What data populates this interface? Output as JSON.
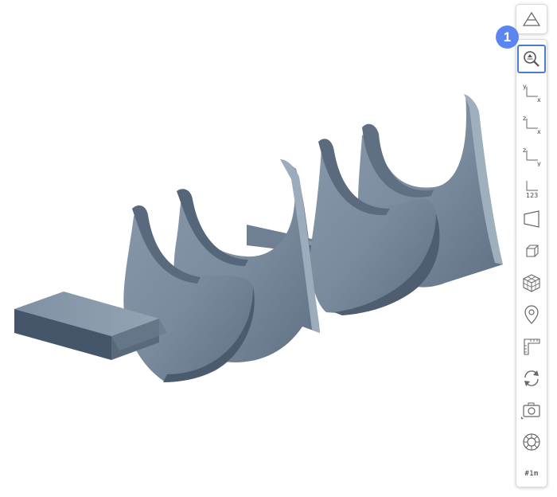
{
  "badge": {
    "number": "1"
  },
  "toolbar": {
    "top_button": {
      "icon": "pyramid-outline-icon"
    },
    "items": [
      {
        "id": "zoom-fit",
        "icon": "zoom-fit-icon",
        "active": true
      },
      {
        "id": "view-xy",
        "icon": "axis-xy-icon",
        "labels": [
          "y",
          "x"
        ]
      },
      {
        "id": "view-zx",
        "icon": "axis-zx-icon",
        "labels": [
          "z",
          "x"
        ]
      },
      {
        "id": "view-zy",
        "icon": "axis-zy-icon",
        "labels": [
          "z",
          "y"
        ]
      },
      {
        "id": "view-iso",
        "icon": "axis-iso-icon",
        "label": "123"
      },
      {
        "id": "perspective",
        "icon": "perspective-plane-icon"
      },
      {
        "id": "box-view",
        "icon": "cube-outline-icon"
      },
      {
        "id": "mesh-view",
        "icon": "mesh-cube-icon"
      },
      {
        "id": "pin",
        "icon": "map-pin-icon"
      },
      {
        "id": "measure",
        "icon": "ruler-corner-icon"
      },
      {
        "id": "rotate",
        "icon": "rotate-arrows-icon"
      },
      {
        "id": "screenshot",
        "icon": "camera-icon"
      },
      {
        "id": "settings",
        "icon": "ring-settings-icon"
      },
      {
        "id": "scale",
        "icon": "scale-label-icon",
        "label": "#1m"
      }
    ]
  },
  "colors": {
    "model_fill": "#7d8ea1",
    "model_dark": "#4d5d6f",
    "model_light": "#a3b2c2",
    "accent": "#4a7bd6",
    "badge": "#5b86f2"
  }
}
